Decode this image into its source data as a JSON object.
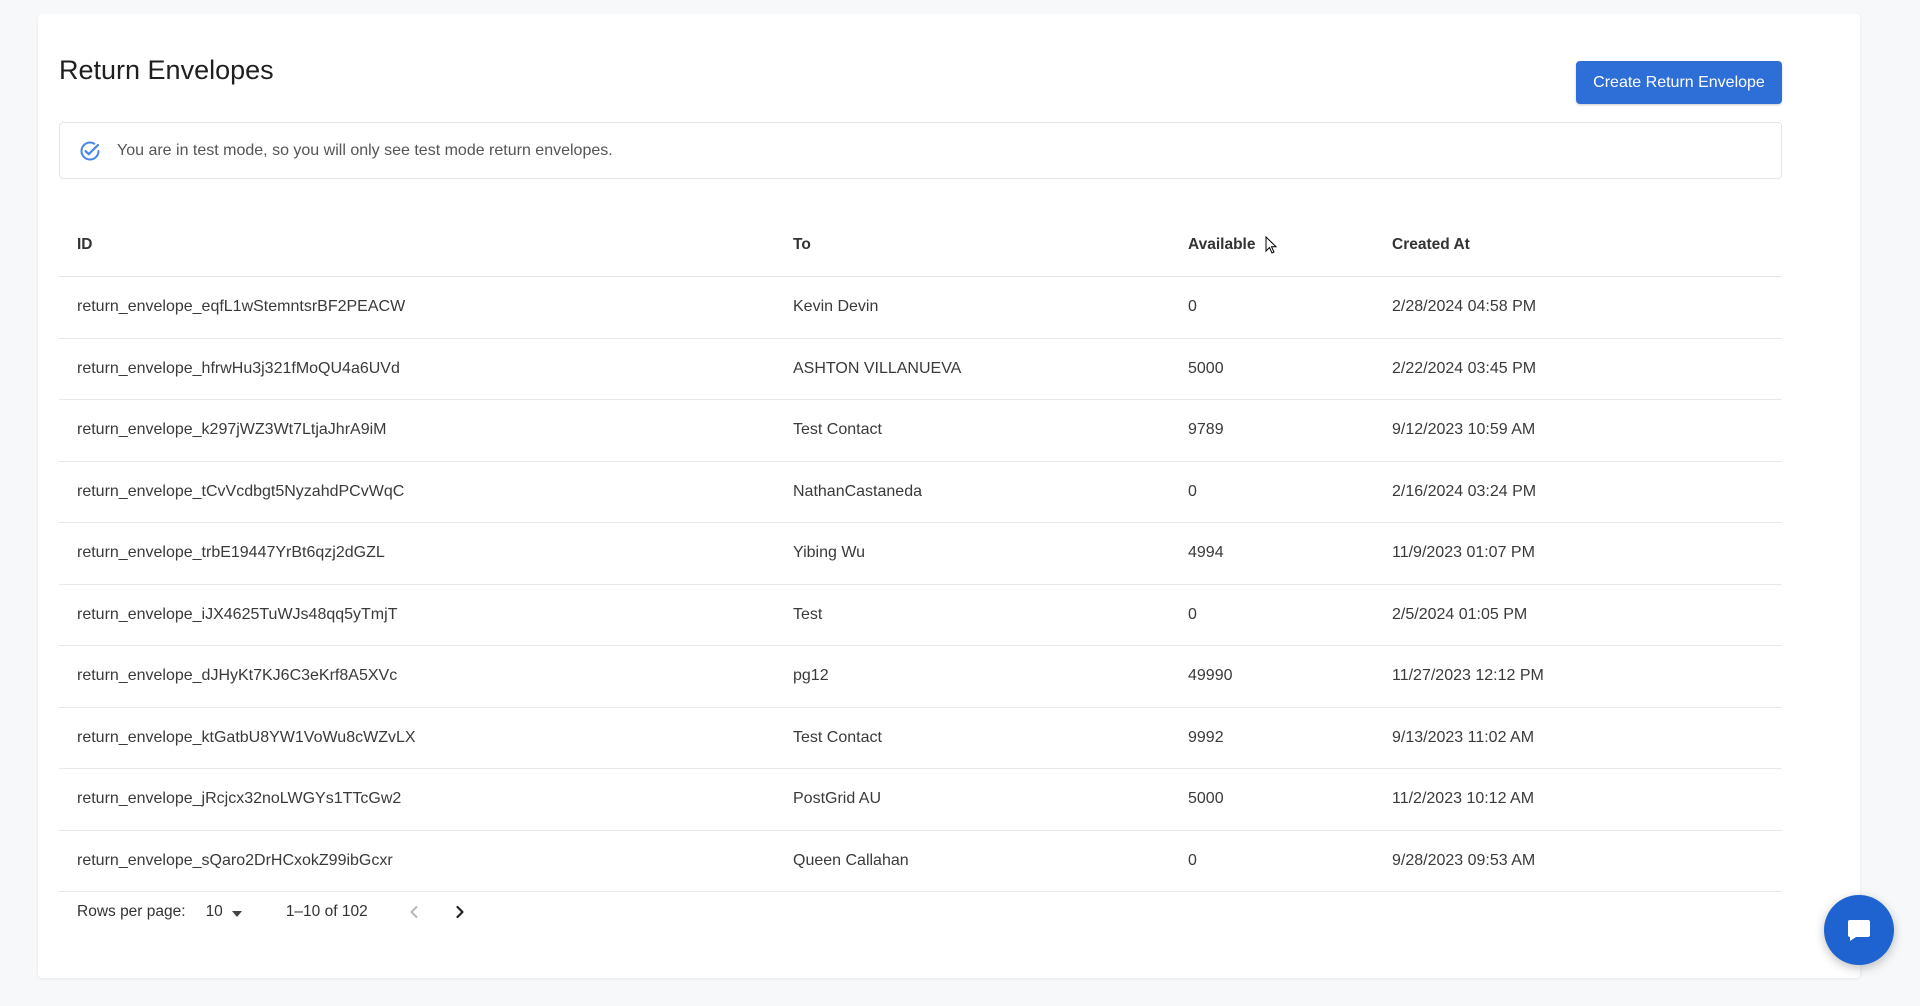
{
  "page": {
    "title": "Return Envelopes",
    "create_button_label": "Create Return Envelope"
  },
  "notice": {
    "text": "You are in test mode, so you will only see test mode return envelopes.",
    "icon": "check-circle-icon",
    "icon_color": "#4a86e8"
  },
  "table": {
    "headers": [
      "ID",
      "To",
      "Available",
      "Created At"
    ],
    "rows": [
      {
        "id": "return_envelope_eqfL1wStemntsrBF2PEACW",
        "to": "Kevin Devin",
        "available": "0",
        "created_at": "2/28/2024 04:58 PM"
      },
      {
        "id": "return_envelope_hfrwHu3j321fMoQU4a6UVd",
        "to": "ASHTON VILLANUEVA",
        "available": "5000",
        "created_at": "2/22/2024 03:45 PM"
      },
      {
        "id": "return_envelope_k297jWZ3Wt7LtjaJhrA9iM",
        "to": "Test Contact",
        "available": "9789",
        "created_at": "9/12/2023 10:59 AM"
      },
      {
        "id": "return_envelope_tCvVcdbgt5NyzahdPCvWqC",
        "to": "NathanCastaneda",
        "available": "0",
        "created_at": "2/16/2024 03:24 PM"
      },
      {
        "id": "return_envelope_trbE19447YrBt6qzj2dGZL",
        "to": "Yibing Wu",
        "available": "4994",
        "created_at": "11/9/2023 01:07 PM"
      },
      {
        "id": "return_envelope_iJX4625TuWJs48qq5yTmjT",
        "to": "Test",
        "available": "0",
        "created_at": "2/5/2024 01:05 PM"
      },
      {
        "id": "return_envelope_dJHyKt7KJ6C3eKrf8A5XVc",
        "to": "pg12",
        "available": "49990",
        "created_at": "11/27/2023 12:12 PM"
      },
      {
        "id": "return_envelope_ktGatbU8YW1VoWu8cWZvLX",
        "to": "Test Contact",
        "available": "9992",
        "created_at": "9/13/2023 11:02 AM"
      },
      {
        "id": "return_envelope_jRcjcx32noLWGYs1TTcGw2",
        "to": "PostGrid AU",
        "available": "5000",
        "created_at": "11/2/2023 10:12 AM"
      },
      {
        "id": "return_envelope_sQaro2DrHCxokZ99ibGcxr",
        "to": "Queen Callahan",
        "available": "0",
        "created_at": "9/28/2023 09:53 AM"
      }
    ]
  },
  "pagination": {
    "rows_per_page_label": "Rows per page:",
    "rows_per_page_value": "10",
    "range_text": "1–10 of 102"
  },
  "colors": {
    "accent": "#2d6fd6",
    "chat_button": "#1e63d0"
  },
  "icons": {
    "prev": "chevron-left-icon",
    "next": "chevron-right-icon",
    "chat": "chat-bubble-icon"
  }
}
